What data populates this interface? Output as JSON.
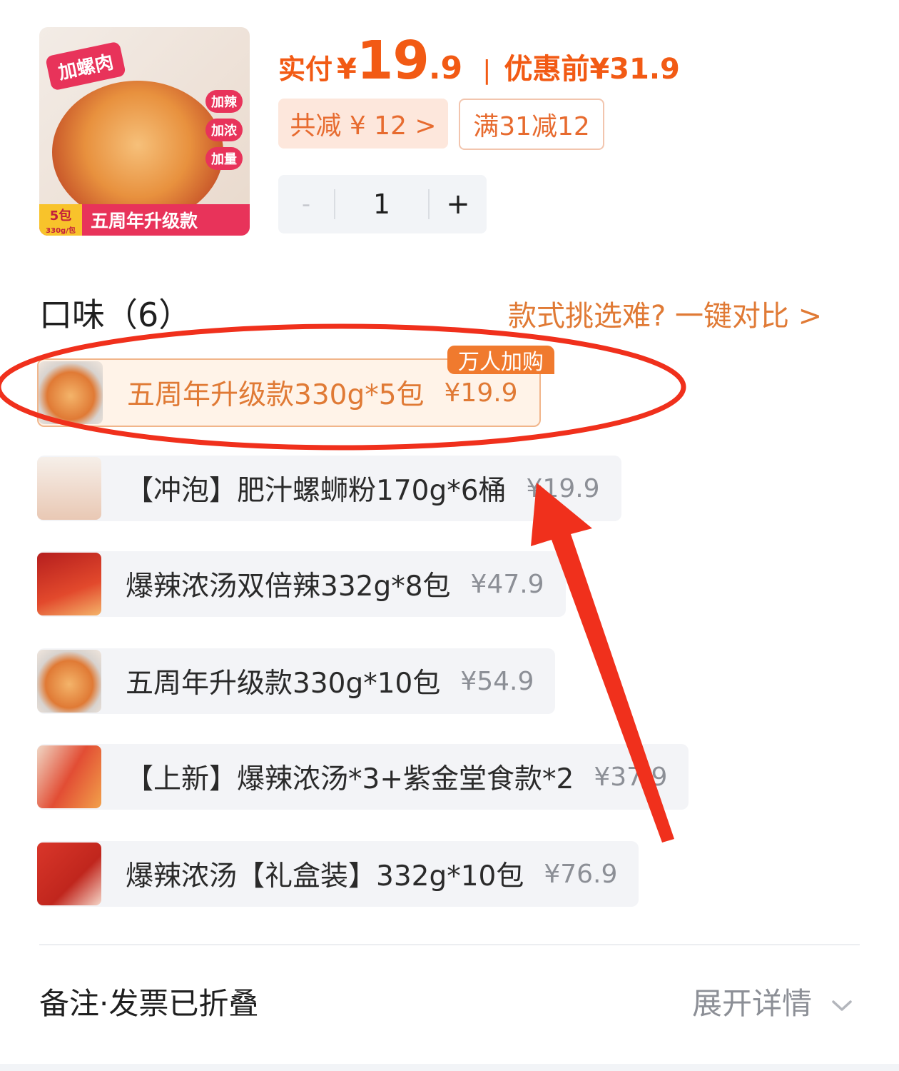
{
  "product": {
    "image_top_tag": "加螺肉",
    "image_side_tags": [
      "加辣",
      "加浓",
      "加量"
    ],
    "image_pack_count": "5包",
    "image_pack_weight": "330g/包",
    "image_bottom_text": "五周年升级款"
  },
  "price": {
    "paid_label": "实付",
    "currency": "¥",
    "paid_int": "19",
    "paid_dec": ".9",
    "separator": "|",
    "original_text": "优惠前¥31.9",
    "discount_chip": "共减 ¥ 12 >",
    "coupon_chip": "满31减12"
  },
  "stepper": {
    "minus": "-",
    "quantity": "1",
    "plus": "+"
  },
  "flavor": {
    "title": "口味（6）",
    "compare_link": "款式挑选难? 一键对比 >",
    "hot_badge": "万人加购",
    "options": [
      {
        "name": "五周年升级款330g*5包",
        "price": "¥19.9",
        "selected": true
      },
      {
        "name": "【冲泡】肥汁螺蛳粉170g*6桶",
        "price": "¥19.9",
        "selected": false
      },
      {
        "name": "爆辣浓汤双倍辣332g*8包",
        "price": "¥47.9",
        "selected": false
      },
      {
        "name": "五周年升级款330g*10包",
        "price": "¥54.9",
        "selected": false
      },
      {
        "name": "【上新】爆辣浓汤*3+紫金堂食款*2",
        "price": "¥37.9",
        "selected": false
      },
      {
        "name": "爆辣浓汤【礼盒装】332g*10包",
        "price": "¥76.9",
        "selected": false
      }
    ]
  },
  "footer": {
    "note_label": "备注·发票已折叠",
    "expand_label": "展开详情",
    "expand_icon": "chevron-down-icon"
  },
  "colors": {
    "accent": "#f25a14",
    "orange_text": "#e07a35",
    "annotation_red": "#f0301c"
  }
}
